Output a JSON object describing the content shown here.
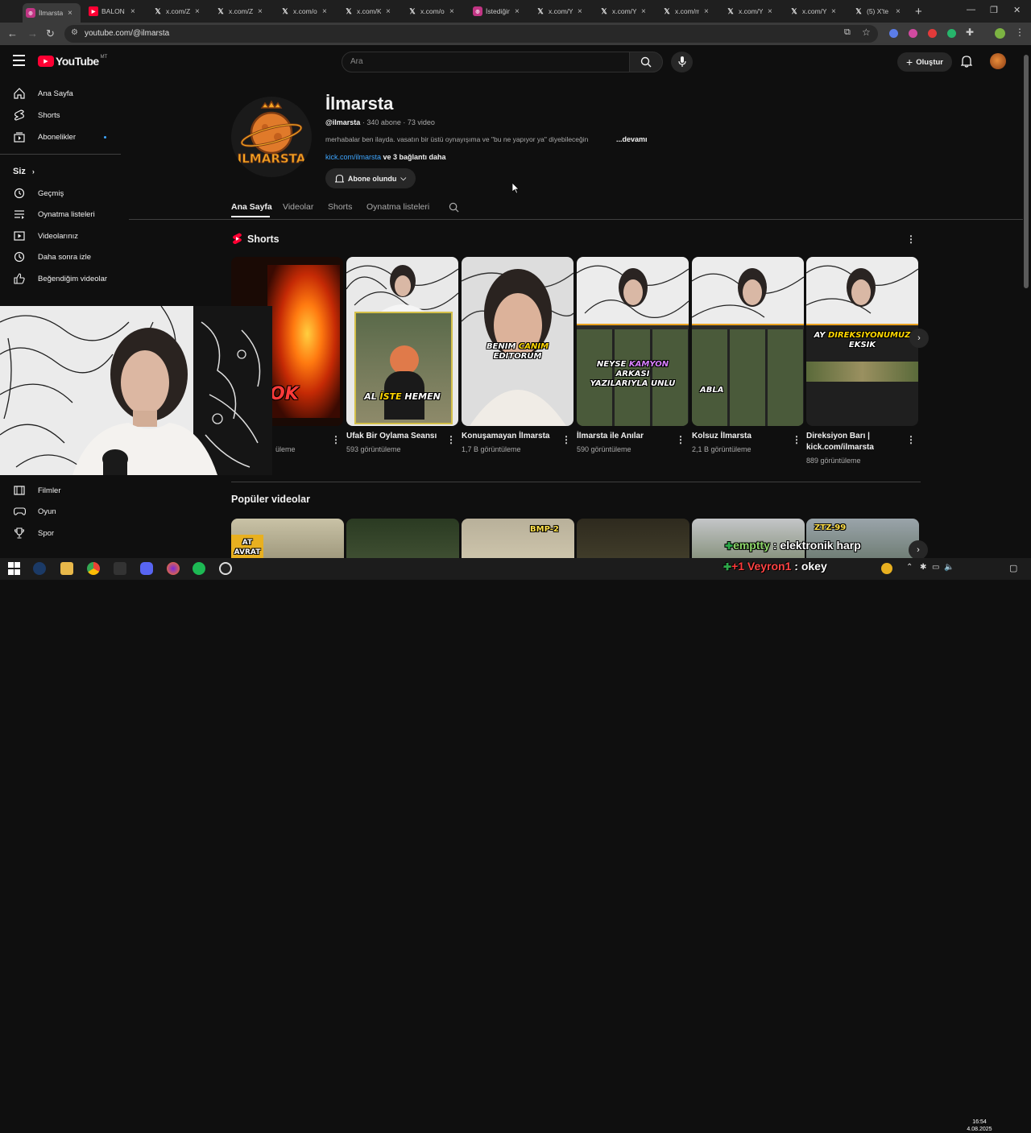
{
  "browser": {
    "tabs": [
      {
        "icon": "instagram-icon",
        "title": "İlmarsta",
        "active": true
      },
      {
        "icon": "youtube-icon",
        "title": "BALON D"
      },
      {
        "icon": "x-icon",
        "title": "x.com/Za"
      },
      {
        "icon": "x-icon",
        "title": "x.com/Za"
      },
      {
        "icon": "x-icon",
        "title": "x.com/or"
      },
      {
        "icon": "x-icon",
        "title": "x.com/Ka"
      },
      {
        "icon": "x-icon",
        "title": "x.com/or"
      },
      {
        "icon": "instagram-icon",
        "title": "İstediğin"
      },
      {
        "icon": "x-icon",
        "title": "x.com/Yi"
      },
      {
        "icon": "x-icon",
        "title": "x.com/Yi"
      },
      {
        "icon": "x-icon",
        "title": "x.com/m"
      },
      {
        "icon": "x-icon",
        "title": "x.com/Yi"
      },
      {
        "icon": "x-icon",
        "title": "x.com/Yi"
      },
      {
        "icon": "x-icon",
        "title": "(5) X'te"
      }
    ],
    "url": "youtube.com/@ilmarsta"
  },
  "masthead": {
    "logo_text": "YouTube",
    "region": "MT",
    "search_placeholder": "Ara",
    "create_label": "Oluştur"
  },
  "sidebar": {
    "items": [
      {
        "icon": "home-icon",
        "label": "Ana Sayfa"
      },
      {
        "icon": "shorts-icon",
        "label": "Shorts"
      },
      {
        "icon": "subscriptions-icon",
        "label": "Abonelikler"
      }
    ],
    "you_label": "Siz",
    "you_items": [
      {
        "icon": "history-icon",
        "label": "Geçmiş"
      },
      {
        "icon": "playlists-icon",
        "label": "Oynatma listeleri"
      },
      {
        "icon": "your-videos-icon",
        "label": "Videolarınız"
      },
      {
        "icon": "watch-later-icon",
        "label": "Daha sonra izle"
      },
      {
        "icon": "liked-icon",
        "label": "Beğendiğim videolar"
      }
    ],
    "explore_items": [
      {
        "icon": "movies-icon",
        "label": "Filmler"
      },
      {
        "icon": "gaming-icon",
        "label": "Oyun"
      },
      {
        "icon": "sports-icon",
        "label": "Spor"
      }
    ]
  },
  "channel": {
    "name": "İlmarsta",
    "logo_text": "ILMARSTA",
    "handle": "@ilmarsta",
    "subs": "340 abone",
    "videos": "73 video",
    "sep": "·",
    "description": "merhabalar ben ilayda. vasatın bir üstü oynayışıma ve \"bu ne yapıyor ya\" diyebileceğin",
    "more": "...devamı",
    "link": "kick.com/ilmarsta",
    "link_more": "ve 3 bağlantı daha",
    "subscribed_label": "Abone olundu"
  },
  "channel_tabs": [
    "Ana Sayfa",
    "Videolar",
    "Shorts",
    "Oynatma listeleri"
  ],
  "shorts": {
    "section_title": "Shorts",
    "items": [
      {
        "title": "",
        "views": "üleme",
        "overlay": "OK"
      },
      {
        "title": "Ufak Bir Oylama Seansı",
        "views": "593 görüntüleme",
        "overlay_parts": [
          "AL ",
          "İSTE",
          " HEMEN"
        ]
      },
      {
        "title": "Konuşamayan İlmarsta",
        "views": "1,7 B görüntüleme",
        "overlay_parts": [
          "BENIM ",
          "CANIM",
          " EDITORUM"
        ]
      },
      {
        "title": "İlmarsta ile Anılar",
        "views": "590 görüntüleme",
        "overlay_parts": [
          "NEYSE ",
          "KAMYON",
          "ARKASI ",
          "YAZILARIYLA UNLU"
        ]
      },
      {
        "title": "Kolsuz İlmarsta",
        "views": "2,1 B görüntüleme",
        "overlay": "ABLA"
      },
      {
        "title": "Direksiyon Barı | kick.com/ilmarsta",
        "views": "889 görüntüleme",
        "overlay_parts": [
          "AY ",
          "DIREKSIYONUMUZ",
          "EKSIK"
        ]
      }
    ]
  },
  "popular": {
    "title": "Popüler videolar",
    "thumb_labels": [
      "AT AVRAT",
      "",
      "",
      "BMP-2",
      "",
      "ZTZ-99"
    ]
  },
  "chat": {
    "line1_user": "emptty",
    "line1_text": " : elektronik harp",
    "line2_prefix": "+1",
    "line2_user": "Veyron1",
    "line2_text": " : okey"
  },
  "clock": {
    "time": "16:54",
    "date": "4.08.2025"
  }
}
